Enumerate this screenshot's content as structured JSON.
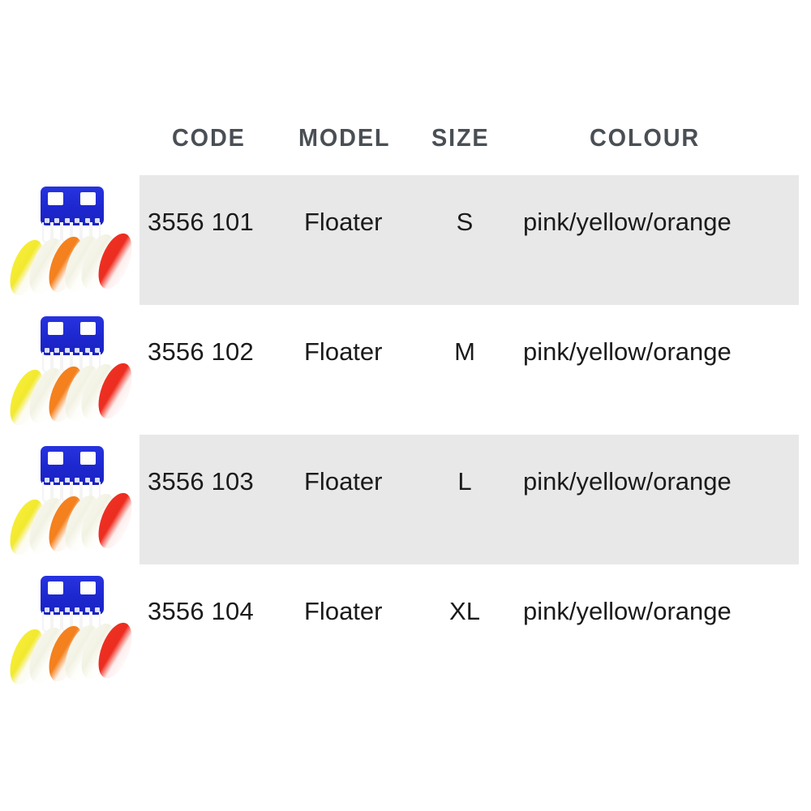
{
  "table": {
    "columns": [
      {
        "key": "code",
        "label": "CODE"
      },
      {
        "key": "model",
        "label": "MODEL"
      },
      {
        "key": "size",
        "label": "SIZE"
      },
      {
        "key": "colour",
        "label": "COLOUR"
      }
    ],
    "rows": [
      {
        "code": "3556 101",
        "model": "Floater",
        "size": "S",
        "colour": "pink/yellow/orange",
        "shaded": true,
        "thumbnail": {
          "name": "float-assortment-card",
          "card_color": "#1d27cf",
          "float_colors": [
            "#f7ef3a",
            "#f2f2e4",
            "#f58220",
            "#f2f2e4",
            "#f7f7ee",
            "#ee3124"
          ]
        }
      },
      {
        "code": "3556 102",
        "model": "Floater",
        "size": "M",
        "colour": "pink/yellow/orange",
        "shaded": false,
        "thumbnail": {
          "name": "float-assortment-card",
          "card_color": "#1d27cf",
          "float_colors": [
            "#f7ef3a",
            "#f2f2e4",
            "#f58220",
            "#f2f2e4",
            "#f7f7ee",
            "#ee3124"
          ]
        }
      },
      {
        "code": "3556 103",
        "model": "Floater",
        "size": "L",
        "colour": "pink/yellow/orange",
        "shaded": true,
        "thumbnail": {
          "name": "float-assortment-card",
          "card_color": "#1d27cf",
          "float_colors": [
            "#f7ef3a",
            "#f2f2e4",
            "#f58220",
            "#f2f2e4",
            "#f7f7ee",
            "#ee3124"
          ]
        }
      },
      {
        "code": "3556 104",
        "model": "Floater",
        "size": "XL",
        "colour": "pink/yellow/orange",
        "shaded": false,
        "thumbnail": {
          "name": "float-assortment-card",
          "card_color": "#1d27cf",
          "float_colors": [
            "#f7ef3a",
            "#f2f2e4",
            "#f58220",
            "#f2f2e4",
            "#f7f7ee",
            "#ee3124"
          ]
        }
      }
    ],
    "styles": {
      "row_shade_color": "#e8e8e8",
      "header_text_color": "#4a4f55",
      "body_text_color": "#1b1b1b",
      "background_color": "#ffffff"
    }
  }
}
